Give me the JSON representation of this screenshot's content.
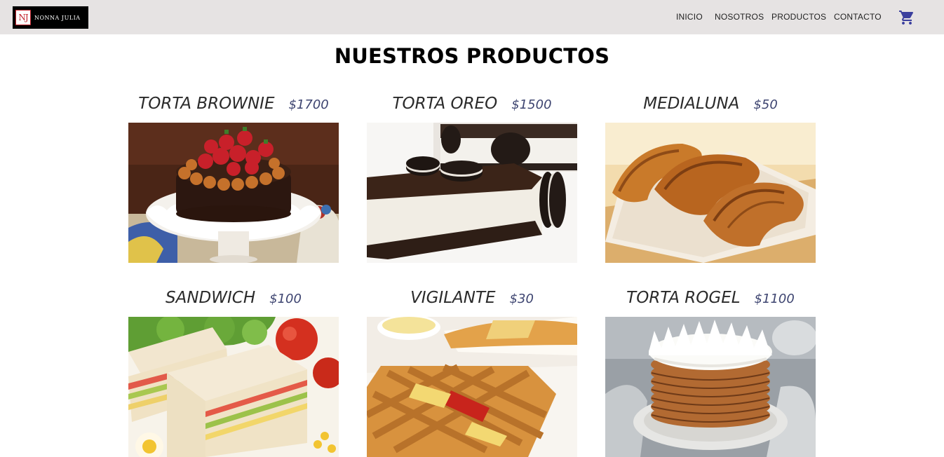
{
  "header": {
    "logo_mark": "NJ",
    "logo_text": "NONNA JULIA",
    "nav": [
      "INICIO",
      "NOSOTROS",
      "PRODUCTOS",
      "CONTACTO"
    ],
    "cart_icon": "shopping-cart-icon"
  },
  "colors": {
    "navbar_bg": "#e6e3e3",
    "price": "#3d4470",
    "cart": "#3b3f9e",
    "logo_accent": "#c2212b"
  },
  "page": {
    "title": "NUESTROS PRODUCTOS"
  },
  "products": [
    {
      "name": "TORTA BROWNIE",
      "price": "$1700",
      "image": "brownie-cake-photo"
    },
    {
      "name": "TORTA OREO",
      "price": "$1500",
      "image": "oreo-cake-photo"
    },
    {
      "name": "MEDIALUNA",
      "price": "$50",
      "image": "croissant-photo"
    },
    {
      "name": "SANDWICH",
      "price": "$100",
      "image": "sandwich-photo"
    },
    {
      "name": "VIGILANTE",
      "price": "$30",
      "image": "vigilante-pastry-photo"
    },
    {
      "name": "TORTA ROGEL",
      "price": "$1100",
      "image": "rogel-cake-photo"
    }
  ]
}
